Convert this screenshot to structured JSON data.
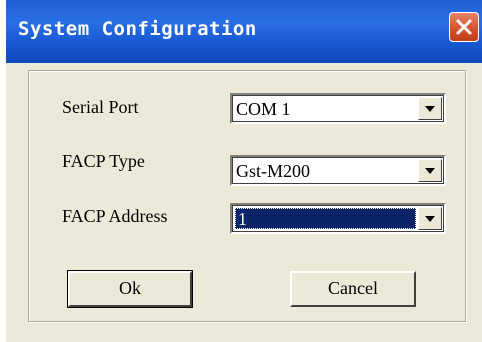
{
  "window": {
    "title": "System Configuration"
  },
  "form": {
    "serial_port": {
      "label": "Serial Port",
      "value": "COM 1"
    },
    "facp_type": {
      "label": "FACP Type",
      "value": "Gst-M200"
    },
    "facp_address": {
      "label": "FACP Address",
      "value": "1"
    }
  },
  "buttons": {
    "ok_label": "Ok",
    "cancel_label": "Cancel"
  },
  "colors": {
    "titlebar": "#1d5fd6",
    "close_button": "#d4522c",
    "dialog_background": "#ece9d8",
    "selection": "#0a246a"
  },
  "icons": {
    "close": "close-icon",
    "dropdown": "chevron-down-icon"
  }
}
